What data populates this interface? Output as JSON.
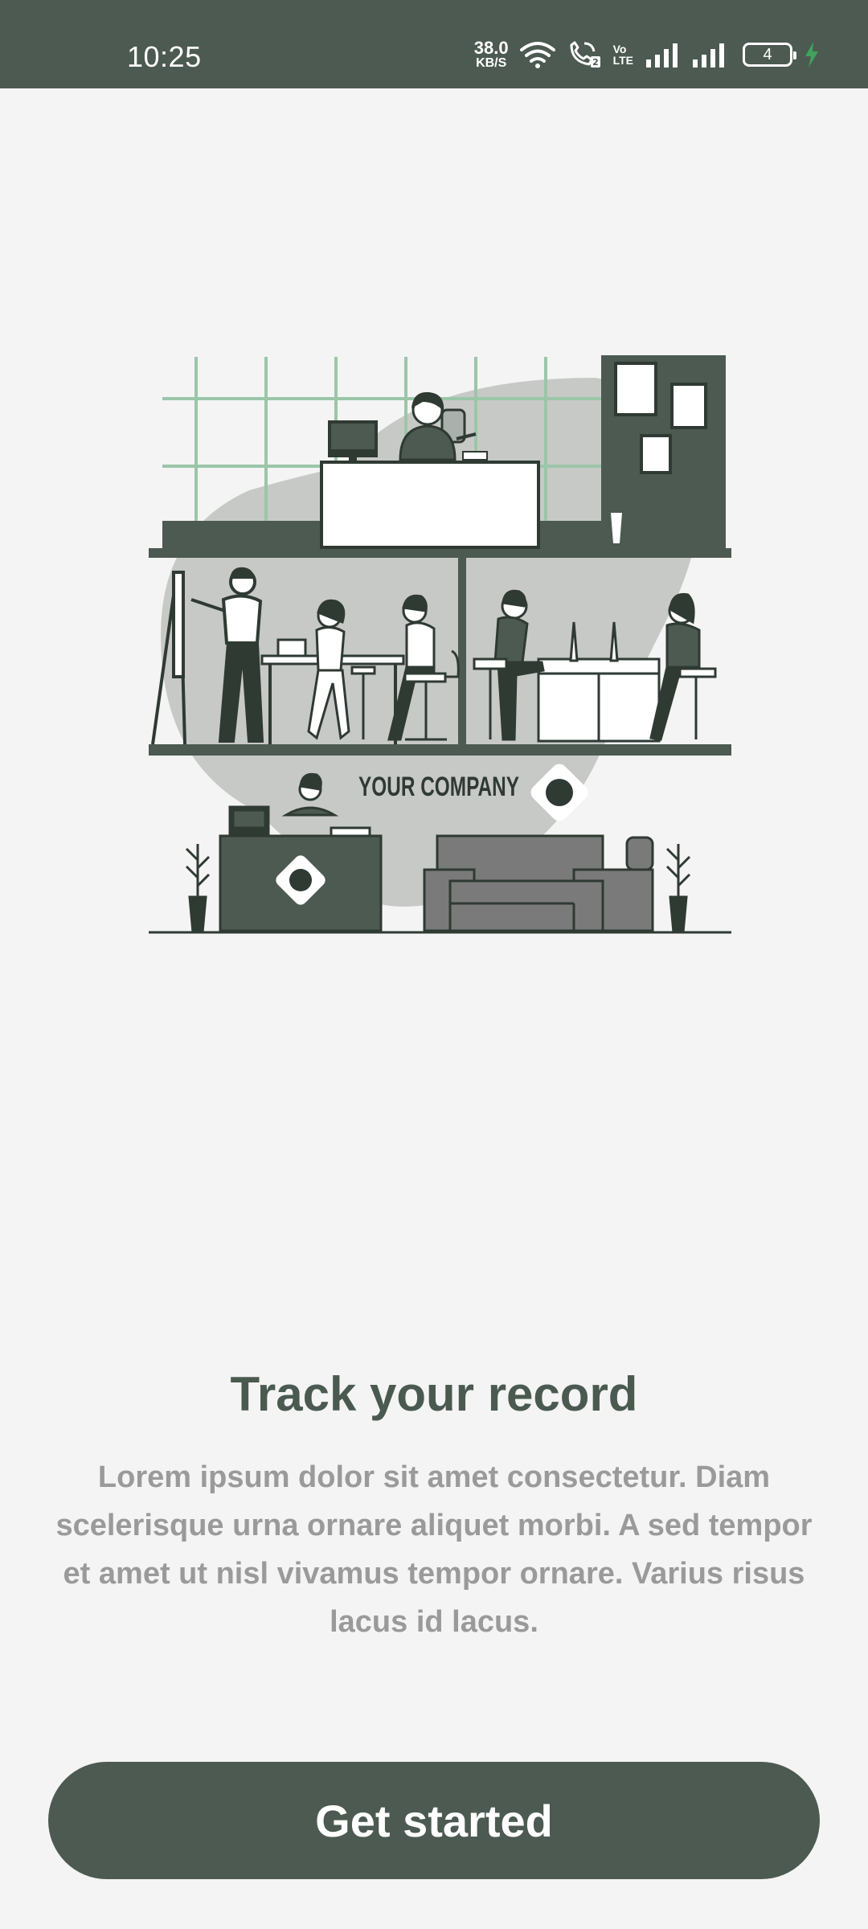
{
  "status_bar": {
    "time": "10:25",
    "net_speed_value": "38.0",
    "net_speed_unit": "KB/S",
    "volte_top": "Vo",
    "volte_bottom": "LTE",
    "sim_badge": "2",
    "battery_level": "4"
  },
  "illustration": {
    "sign_text": "YOUR COMPANY"
  },
  "onboarding": {
    "title": "Track your record",
    "description": "Lorem ipsum dolor sit amet consectetur. Diam scelerisque urna ornare aliquet morbi. A sed tempor et amet ut nisl vivamus tempor ornare. Varius risus lacus id lacus."
  },
  "actions": {
    "get_started_label": "Get started"
  },
  "colors": {
    "primary": "#4c5a51",
    "background": "#f4f4f4",
    "accent_green": "#9bc6a8",
    "blob_gray": "#c7c9c7",
    "text_muted": "#9a9a9a"
  }
}
